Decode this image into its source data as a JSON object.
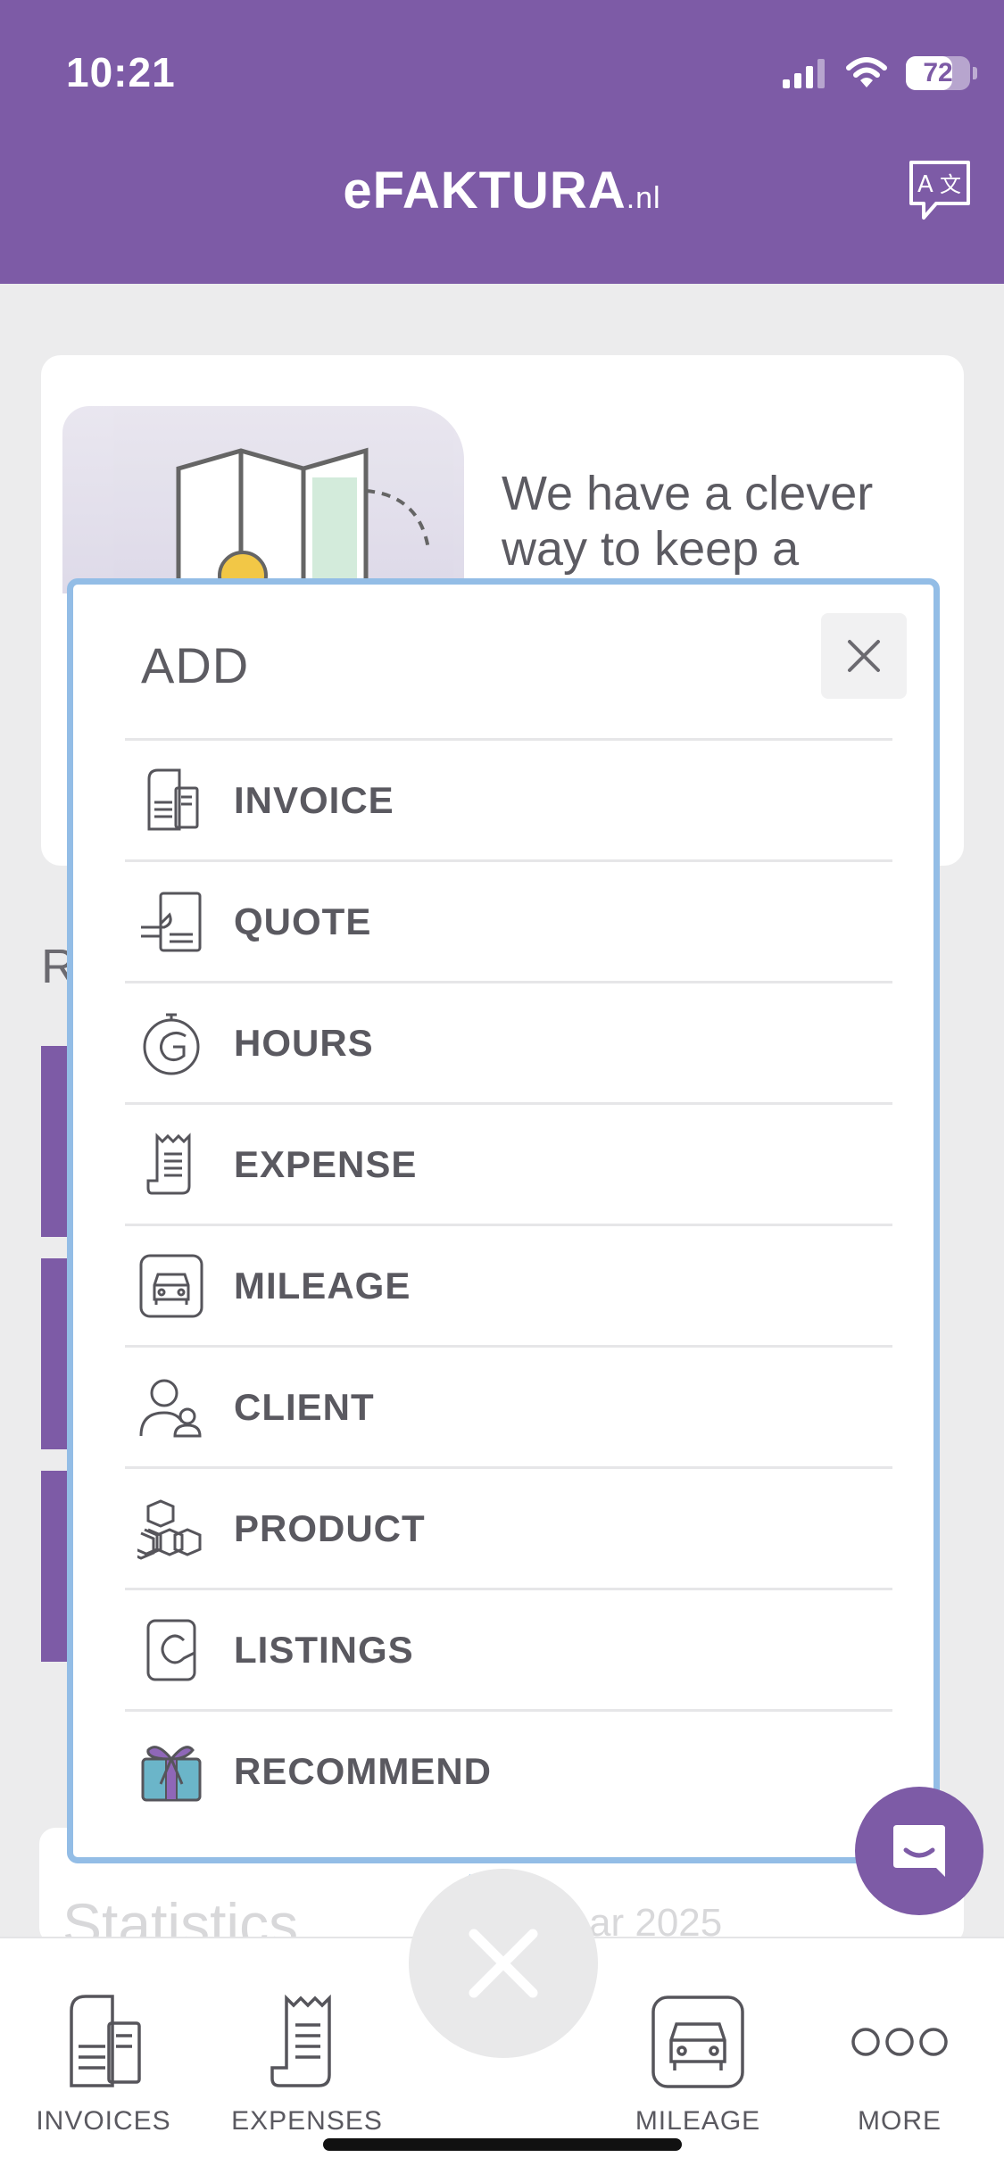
{
  "status_bar": {
    "time": "10:21",
    "battery_percent": "72",
    "battery_level": 0.72
  },
  "header": {
    "brand_main": "eFAKTURA",
    "brand_suffix": ".nl",
    "translate_icon": "translate-icon"
  },
  "background": {
    "card_text": "We have a clever way to keep a",
    "heading_peek": "R",
    "stats_title": "Statistics",
    "stats_year": "ar 2025"
  },
  "modal": {
    "title": "ADD",
    "close_icon": "close-icon",
    "items": [
      {
        "label": "INVOICE",
        "icon": "invoice-icon"
      },
      {
        "label": "QUOTE",
        "icon": "quote-icon"
      },
      {
        "label": "HOURS",
        "icon": "hours-icon"
      },
      {
        "label": "EXPENSE",
        "icon": "expense-icon"
      },
      {
        "label": "MILEAGE",
        "icon": "mileage-icon"
      },
      {
        "label": "CLIENT",
        "icon": "client-icon"
      },
      {
        "label": "PRODUCT",
        "icon": "product-icon"
      },
      {
        "label": "LISTINGS",
        "icon": "listings-icon"
      },
      {
        "label": "RECOMMEND",
        "icon": "gift-icon"
      }
    ]
  },
  "bottom_nav": {
    "items": [
      {
        "label": "INVOICES",
        "icon": "invoices-icon"
      },
      {
        "label": "EXPENSES",
        "icon": "expenses-icon"
      },
      {
        "label": "MILEAGE",
        "icon": "car-icon"
      },
      {
        "label": "MORE",
        "icon": "more-icon"
      }
    ],
    "fab_icon": "close-icon"
  },
  "colors": {
    "brand_purple": "#7d5ba6",
    "modal_border": "#93bde6",
    "text_gray": "#5a5960"
  }
}
